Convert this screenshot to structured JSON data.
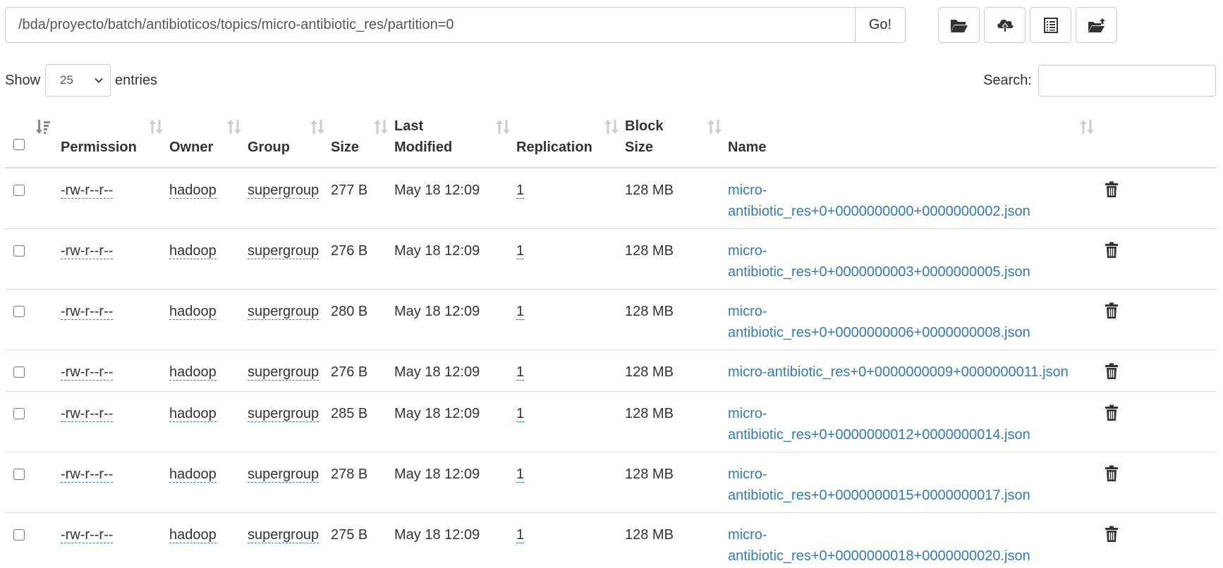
{
  "path_bar": {
    "value": "/bda/proyecto/batch/antibioticos/topics/micro-antibiotic_res/partition=0",
    "go_label": "Go!"
  },
  "toolbar": {
    "buttons": [
      {
        "name": "open-folder-icon"
      },
      {
        "name": "cloud-upload-icon"
      },
      {
        "name": "list-view-icon"
      },
      {
        "name": "create-directory-icon"
      }
    ]
  },
  "length_control": {
    "show_label": "Show",
    "selected": "25",
    "entries_label": "entries"
  },
  "search": {
    "label": "Search:",
    "value": ""
  },
  "table": {
    "columns": {
      "permission": "Permission",
      "owner": "Owner",
      "group": "Group",
      "size": "Size",
      "last_modified_1": "Last",
      "last_modified_2": "Modified",
      "replication": "Replication",
      "block_size_1": "Block",
      "block_size_2": "Size",
      "name": "Name"
    },
    "rows": [
      {
        "permission": "-rw-r--r--",
        "owner": "hadoop",
        "group": "supergroup",
        "size": "277 B",
        "modified": "May 18 12:09",
        "replication": "1",
        "block_size": "128 MB",
        "name_1": "micro-",
        "name_2": "antibiotic_res+0+0000000000+0000000002.json"
      },
      {
        "permission": "-rw-r--r--",
        "owner": "hadoop",
        "group": "supergroup",
        "size": "276 B",
        "modified": "May 18 12:09",
        "replication": "1",
        "block_size": "128 MB",
        "name_1": "micro-",
        "name_2": "antibiotic_res+0+0000000003+0000000005.json"
      },
      {
        "permission": "-rw-r--r--",
        "owner": "hadoop",
        "group": "supergroup",
        "size": "280 B",
        "modified": "May 18 12:09",
        "replication": "1",
        "block_size": "128 MB",
        "name_1": "micro-",
        "name_2": "antibiotic_res+0+0000000006+0000000008.json"
      },
      {
        "permission": "-rw-r--r--",
        "owner": "hadoop",
        "group": "supergroup",
        "size": "276 B",
        "modified": "May 18 12:09",
        "replication": "1",
        "block_size": "128 MB",
        "name_1": "micro-antibiotic_res+0+0000000009+0000000011.json",
        "name_2": ""
      },
      {
        "permission": "-rw-r--r--",
        "owner": "hadoop",
        "group": "supergroup",
        "size": "285 B",
        "modified": "May 18 12:09",
        "replication": "1",
        "block_size": "128 MB",
        "name_1": "micro-",
        "name_2": "antibiotic_res+0+0000000012+0000000014.json"
      },
      {
        "permission": "-rw-r--r--",
        "owner": "hadoop",
        "group": "supergroup",
        "size": "278 B",
        "modified": "May 18 12:09",
        "replication": "1",
        "block_size": "128 MB",
        "name_1": "micro-",
        "name_2": "antibiotic_res+0+0000000015+0000000017.json"
      },
      {
        "permission": "-rw-r--r--",
        "owner": "hadoop",
        "group": "supergroup",
        "size": "275 B",
        "modified": "May 18 12:09",
        "replication": "1",
        "block_size": "128 MB",
        "name_1": "micro-",
        "name_2": "antibiotic_res+0+0000000018+0000000020.json"
      }
    ]
  }
}
